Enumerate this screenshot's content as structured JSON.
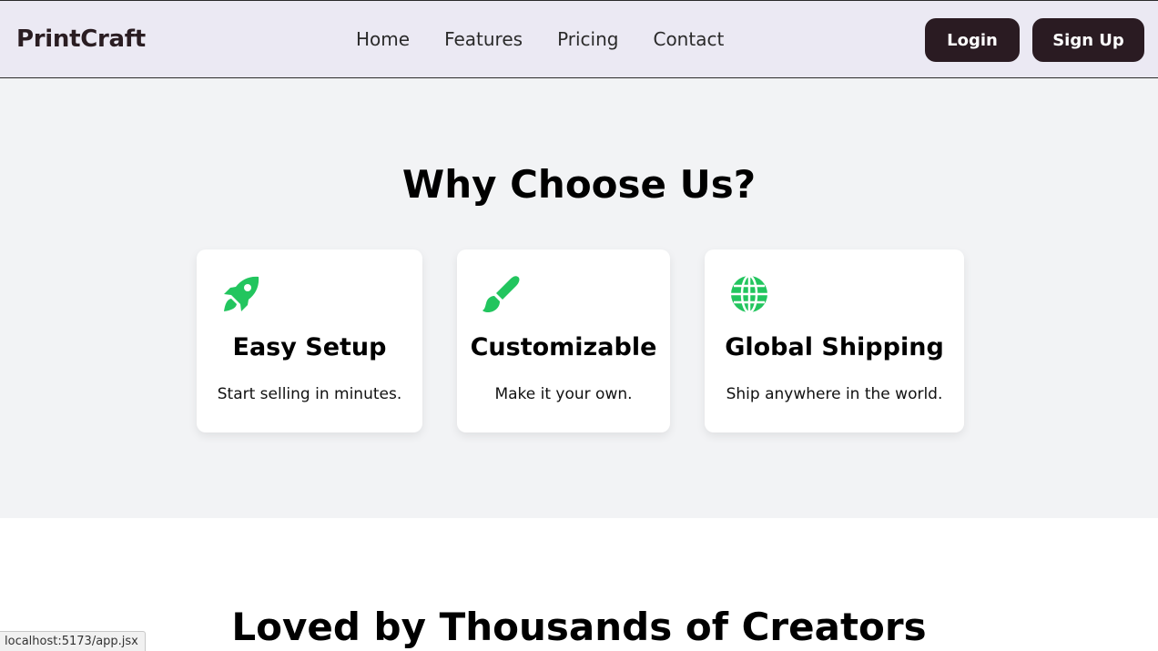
{
  "header": {
    "brand": "PrintCraft",
    "nav": [
      "Home",
      "Features",
      "Pricing",
      "Contact"
    ],
    "login_label": "Login",
    "signup_label": "Sign Up"
  },
  "features": {
    "title": "Why Choose Us?",
    "cards": [
      {
        "icon": "rocket-icon",
        "title": "Easy Setup",
        "desc": "Start selling in minutes."
      },
      {
        "icon": "paintbrush-icon",
        "title": "Customizable",
        "desc": "Make it your own."
      },
      {
        "icon": "globe-icon",
        "title": "Global Shipping",
        "desc": "Ship anywhere in the world."
      }
    ]
  },
  "testimonials": {
    "title": "Loved by Thousands of Creators"
  },
  "status_bar": {
    "url": "localhost:5173/app.jsx"
  },
  "colors": {
    "accent": "#22c55e",
    "button_bg": "#2a1b22",
    "navbar_bg": "#ebe9f3",
    "section_bg": "#f2f3f5"
  }
}
